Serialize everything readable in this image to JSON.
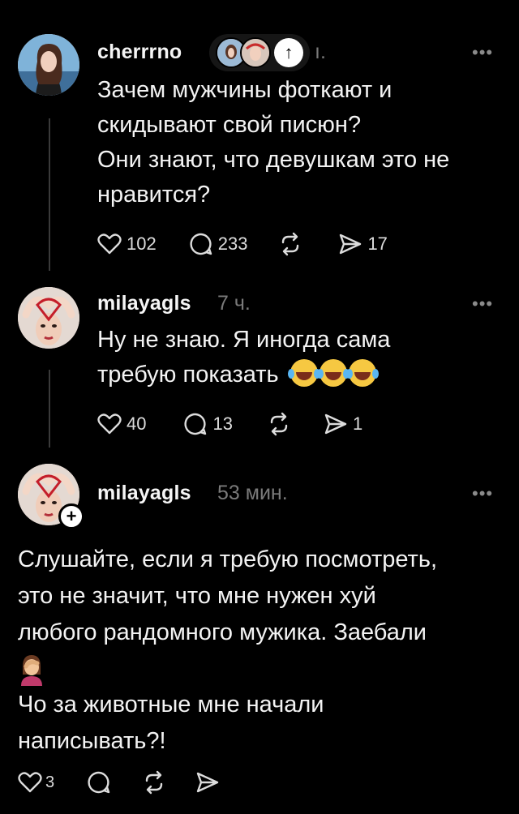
{
  "posts": [
    {
      "username": "cherrrno",
      "time": "ı.",
      "more": "•••",
      "text": [
        "Зачем мужчины фоткают и",
        "скидывают свой писюн?",
        "Они знают, что девушкам это не",
        "нравится?"
      ],
      "likes": "102",
      "replies": "233",
      "shares": "17"
    },
    {
      "username": "milayagls",
      "time": "7 ч.",
      "more": "•••",
      "text": [
        "Ну не знаю. Я иногда сама",
        "требую показать"
      ],
      "likes": "40",
      "replies": "13",
      "shares": "1"
    },
    {
      "username": "milayagls",
      "time": "53 мин.",
      "more": "•••",
      "text": [
        "Слушайте, если я требую посмотреть,",
        "это не значит, что мне нужен хуй",
        "любого рандомного мужика. Заебали",
        "Чо за животные мне начали",
        "написывать?!"
      ],
      "likes": "3"
    }
  ],
  "icons": {
    "heart": "heart-icon",
    "reply": "comment-icon",
    "repost": "repost-icon",
    "share": "send-icon",
    "up_arrow": "arrow-up-icon"
  },
  "colors": {
    "bg": "#000000",
    "text": "#f3f3f3",
    "muted": "#7a7a7a",
    "thread": "#3a3a3a"
  }
}
